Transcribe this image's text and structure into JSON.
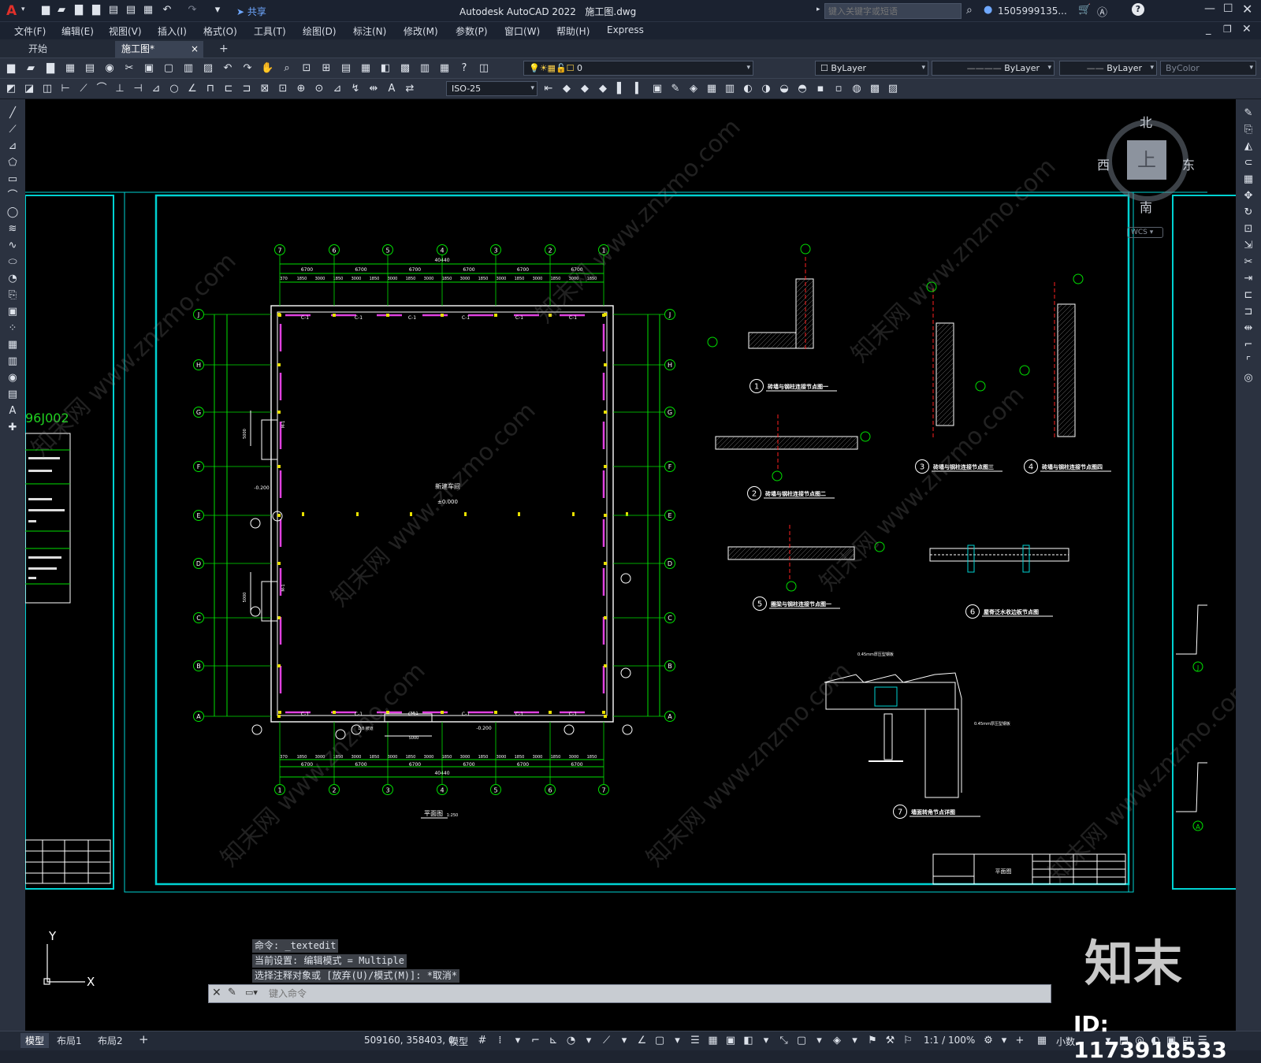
{
  "app": {
    "title": "Autodesk AutoCAD 2022",
    "filename": "施工图.dwg",
    "search_placeholder": "键入关键字或短语",
    "user": "1505999135...",
    "share_label": "共享",
    "logo_letter": "A"
  },
  "menu": [
    "文件(F)",
    "编辑(E)",
    "视图(V)",
    "插入(I)",
    "格式(O)",
    "工具(T)",
    "绘图(D)",
    "标注(N)",
    "修改(M)",
    "参数(P)",
    "窗口(W)",
    "帮助(H)",
    "Express"
  ],
  "tabs": {
    "start": "开始",
    "active": "施工图*",
    "close": "×",
    "add": "+"
  },
  "properties": {
    "layer": "0",
    "color": "ByLayer",
    "linetype": "ByLayer",
    "lineweight": "ByLayer",
    "plotstyle": "ByColor",
    "dimstyle": "ISO-25"
  },
  "viewcube": {
    "north": "北",
    "south": "南",
    "east": "东",
    "west": "西",
    "face": "上",
    "wcs": "WCS"
  },
  "drawing": {
    "main_title": "平面图",
    "main_scale": "1:250",
    "hall_name": "新建车间",
    "hall_level": "±0.000",
    "overall_width": "40440",
    "axis_top": [
      "7",
      "6",
      "5",
      "4",
      "3",
      "2",
      "1"
    ],
    "axis_bottom": [
      "1",
      "2",
      "3",
      "4",
      "5",
      "6",
      "7"
    ],
    "axis_side": [
      "J",
      "H",
      "G",
      "F",
      "E",
      "D",
      "C",
      "B",
      "A"
    ],
    "span": "6700",
    "sub_dims": [
      "370",
      "1850",
      "3000",
      "1850"
    ],
    "door_label": "M-1",
    "window_label": "C-1",
    "level_1": "-0.200",
    "ramp_note": "1:8 坡道",
    "door_width": "5000",
    "left_code": "96J002",
    "details": [
      {
        "num": "1",
        "title": "砖墙与钢柱连接节点图一"
      },
      {
        "num": "2",
        "title": "砖墙与钢柱连接节点图二"
      },
      {
        "num": "3",
        "title": "砖墙与钢柱连接节点图三"
      },
      {
        "num": "4",
        "title": "砖墙与钢柱连接节点图四"
      },
      {
        "num": "5",
        "title": "圈梁与钢柱连接节点图一"
      },
      {
        "num": "6",
        "title": "屋脊泛水收边板节点图"
      },
      {
        "num": "7",
        "title": "墙面转角节点详图"
      }
    ],
    "note_045": "0.45mm厚压型钢板",
    "titleblock_name": "平面图"
  },
  "command": {
    "lines": [
      "命令: _textedit",
      "当前设置: 编辑模式 = Multiple",
      "选择注释对象或 [放弃(U)/模式(M)]: *取消*"
    ],
    "placeholder": "键入命令"
  },
  "layout_tabs": [
    "模型",
    "布局1",
    "布局2"
  ],
  "status": {
    "coords": "509160, 358403, 0",
    "model": "模型",
    "scale": "1:1 / 100%",
    "units": "小数"
  },
  "watermark": {
    "brand": "知末",
    "id": "ID: 1173918533",
    "site": "知末网 www.znzmo.com"
  },
  "colors": {
    "canvas": "#000000",
    "frame": "#00d2d2",
    "dim": "#00e000",
    "wall": "#ffffff",
    "magenta": "#e040e0",
    "yellow": "#e8e000",
    "red": "#ff2020"
  }
}
